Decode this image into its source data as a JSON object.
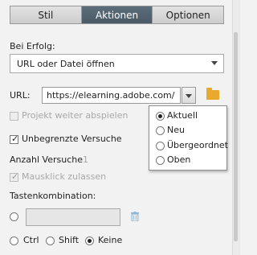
{
  "tabs": [
    {
      "label": "Stil",
      "active": false
    },
    {
      "label": "Aktionen",
      "active": true
    },
    {
      "label": "Optionen",
      "active": false
    }
  ],
  "on_success": {
    "label": "Bei Erfolg:",
    "selected": "URL oder Datei öffnen"
  },
  "url": {
    "label": "URL:",
    "value": "https://elearning.adobe.com/"
  },
  "url_target_popup": {
    "options": [
      "Aktuell",
      "Neu",
      "Übergeordnet",
      "Oben"
    ],
    "selected": "Aktuell"
  },
  "options": {
    "continue_project": {
      "label": "Projekt weiter abspielen",
      "checked": false,
      "enabled": false
    },
    "unlimited_attempts": {
      "label": "Unbegrenzte Versuche",
      "checked": true,
      "enabled": true
    },
    "attempts_label": "Anzahl Versuche",
    "attempts_value": "1",
    "allow_mouseclick": {
      "label": "Mausklick zulassen",
      "checked": true,
      "enabled": false
    }
  },
  "shortcut": {
    "label": "Tastenkombination:",
    "modifiers": [
      "Ctrl",
      "Shift",
      "Keine"
    ],
    "selected_modifier": "Keine"
  },
  "colors": {
    "active_tab": "#4f5f6c",
    "folder": "#e8a92c",
    "trash": "#8fb6d6"
  }
}
